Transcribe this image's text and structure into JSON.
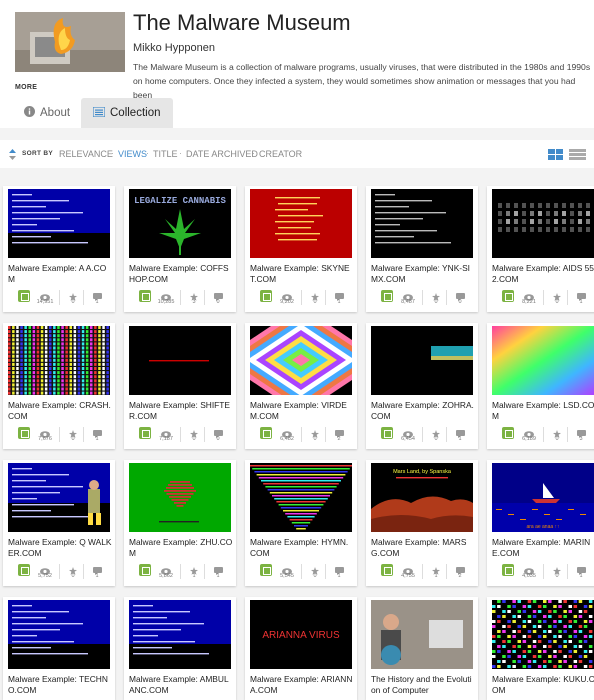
{
  "header": {
    "title": "The Malware Museum",
    "creator": "Mikko Hypponen",
    "description": "The Malware Museum is a collection of malware programs, usually viruses, that were distributed in the 1980s and 1990s on home computers. Once they infected a system, they would sometimes show animation or messages that you had been",
    "more_label": "MORE"
  },
  "tabs": {
    "about": "About",
    "collection": "Collection"
  },
  "sort": {
    "label": "SORT BY",
    "options": [
      "RELEVANCE",
      "VIEWS",
      "TITLE",
      "DATE ARCHIVED",
      "CREATOR"
    ],
    "active": "VIEWS"
  },
  "items": [
    {
      "title": "Malware Example: A A.COM",
      "views": "14,951",
      "favs": "0",
      "reviews": "1",
      "thumb": "dos-blue"
    },
    {
      "title": "Malware Example: COFFSHOP.COM",
      "views": "10,285",
      "favs": "3",
      "reviews": "0",
      "thumb": "coffshop"
    },
    {
      "title": "Malware Example: SKYNET.COM",
      "views": "9,202",
      "favs": "0",
      "reviews": "1",
      "thumb": "skynet"
    },
    {
      "title": "Malware Example: YNK-SIMX.COM",
      "views": "8,487",
      "favs": "0",
      "reviews": "0",
      "thumb": "ynk"
    },
    {
      "title": "Malware Example: AIDS 552.COM",
      "views": "8,221",
      "favs": "0",
      "reviews": "1",
      "thumb": "aids"
    },
    {
      "title": "Malware Example: CRASH.COM",
      "views": "7,676",
      "favs": "0",
      "reviews": "1",
      "thumb": "crash"
    },
    {
      "title": "Malware Example: SHIFTER.COM",
      "views": "7,187",
      "favs": "0",
      "reviews": "0",
      "thumb": "shifter"
    },
    {
      "title": "Malware Example: VIRDEM.COM",
      "views": "6,482",
      "favs": "0",
      "reviews": "2",
      "thumb": "virdem"
    },
    {
      "title": "Malware Example: ZOHRA.COM",
      "views": "6,454",
      "favs": "0",
      "reviews": "1",
      "thumb": "zohra"
    },
    {
      "title": "Malware Example: LSD.COM",
      "views": "6,189",
      "favs": "0",
      "reviews": "3",
      "thumb": "lsd"
    },
    {
      "title": "Malware Example: Q WALKER.COM",
      "views": "5,752",
      "favs": "0",
      "reviews": "1",
      "thumb": "walker"
    },
    {
      "title": "Malware Example: ZHU.COM",
      "views": "5,862",
      "favs": "1",
      "reviews": "1",
      "thumb": "zhu"
    },
    {
      "title": "Malware Example: HYMN.COM",
      "views": "5,545",
      "favs": "0",
      "reviews": "1",
      "thumb": "hymn"
    },
    {
      "title": "Malware Example: MARS G.COM",
      "views": "4,755",
      "favs": "1",
      "reviews": "2",
      "thumb": "mars"
    },
    {
      "title": "Malware Example: MARINE.COM",
      "views": "4,035",
      "favs": "0",
      "reviews": "1",
      "thumb": "marine"
    },
    {
      "title": "Malware Example: TECHNO.COM",
      "views": "",
      "favs": "",
      "reviews": "",
      "thumb": "dos-blue"
    },
    {
      "title": "Malware Example: AMBULANC.COM",
      "views": "",
      "favs": "",
      "reviews": "",
      "thumb": "dos-blue"
    },
    {
      "title": "Malware Example: ARIANNA.COM",
      "views": "",
      "favs": "",
      "reviews": "",
      "thumb": "arianna"
    },
    {
      "title": "The History and the Evolution of Computer",
      "views": "",
      "favs": "",
      "reviews": "",
      "thumb": "history"
    },
    {
      "title": "Malware Example: KUKU.COM",
      "views": "",
      "favs": "",
      "reviews": "",
      "thumb": "kuku"
    }
  ],
  "thumb_text": {
    "coffshop": "LEGALIZE CANNABIS",
    "arianna": "ARIANNA VIRUS",
    "mars": "Mars Land, by Spanska",
    "marine": "ara ae anaa ↑↑"
  },
  "colors": {
    "accent": "#428bca",
    "collection_icon": "#7cb342",
    "dos_blue": "#0000a8",
    "skynet_red": "#bb0000",
    "zhu_green": "#00a800"
  },
  "icons": {
    "about": "info-icon",
    "collection": "list-icon",
    "sort": "sort-arrows-icon",
    "views": "eye-icon",
    "favs": "star-icon",
    "reviews": "comment-icon",
    "collection_badge": "collection-icon"
  }
}
